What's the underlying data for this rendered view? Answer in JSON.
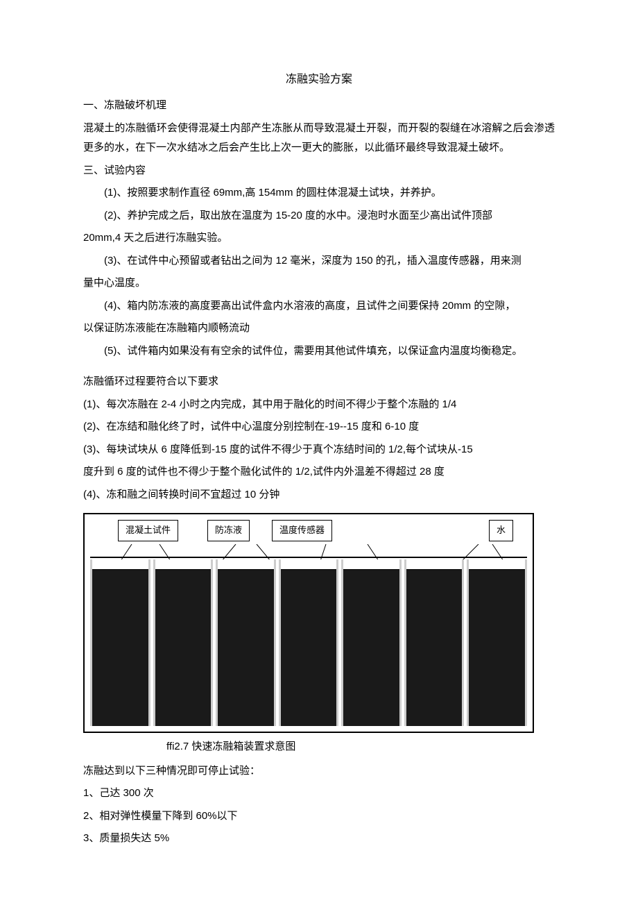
{
  "title": "冻融实验方案",
  "section1_heading": "一、冻融破坏机理",
  "section1_para": "混凝土的冻融循环会使得混凝土内部产生冻胀从而导致混凝土开裂，而开裂的裂缝在冰溶解之后会渗透更多的水，在下一次水结冰之后会产生比上次一更大的膨胀，以此循环最终导致混凝土破坏。",
  "section3_heading": "三、试验内容",
  "content_items": [
    "(1)、按照要求制作直径 69mm,高 154mm 的圆柱体混凝土试块，并养护。",
    "(2)、养护完成之后，取出放在温度为 15-20 度的水中。浸泡时水面至少高出试件顶部",
    "(3)、在试件中心预留或者钻出之间为 12 毫米，深度为 150 的孔，插入温度传感器，用来测",
    "(4)、箱内防冻液的高度要高出试件盒内水溶液的高度，且试件之间要保持 20mm 的空隙，",
    "(5)、试件箱内如果没有有空余的试件位，需要用其他试件填充，以保证盒内温度均衡稳定。"
  ],
  "content_cont": {
    "c2": "20mm,4 天之后进行冻融实验。",
    "c3": "量中心温度。",
    "c4": "以保证防冻液能在冻融箱内顺畅流动"
  },
  "cycle_heading": "冻融循环过程要符合以下要求",
  "cycle_items": [
    "(1)、每次冻融在 2-4 小时之内完成，其中用于融化的时间不得少于整个冻融的 1/4",
    "(2)、在冻结和融化终了时，试件中心温度分别控制在-19--15 度和 6-10 度",
    "(3)、每块试块从 6 度降低到-15 度的试件不得少于真个冻结时间的 1/2,每个试块从-15",
    "(4)、冻和融之间转换时间不宜超过 10 分钟"
  ],
  "cycle_cont": "度升到 6 度的试件也不得少于整个融化试件的 1/2,试件内外温差不得超过 28 度",
  "fig_labels": {
    "l1": "混凝土试件",
    "l2": "防冻液",
    "l3": "温度传感器",
    "l4": "水"
  },
  "caption": "ffi2.7 快速冻融箱装置求意图",
  "stop_heading": "冻融达到以下三种情况即可停止试验：",
  "stop_items": [
    "1、己达 300 次",
    "2、相对弹性模量下降到 60%以下",
    "3、质量损失达 5%"
  ]
}
